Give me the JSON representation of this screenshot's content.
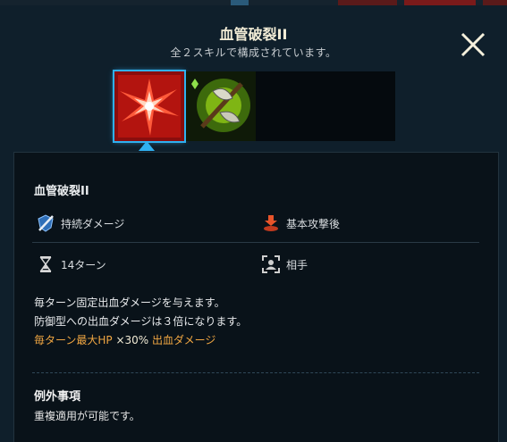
{
  "header": {
    "title": "血管破裂II",
    "subtitle": "全２スキルで構成されています。"
  },
  "skills": {
    "selected_index": 0,
    "icons": [
      "blood-burst-icon",
      "green-axe-icon",
      "empty-slot",
      "empty-slot"
    ]
  },
  "detail": {
    "name": "血管破裂II",
    "attributes": {
      "type": {
        "label": "持続ダメージ",
        "icon": "sword-shield-icon"
      },
      "timing": {
        "label": "基本攻撃後",
        "icon": "trigger-icon"
      },
      "duration": {
        "label": "14ターン",
        "icon": "hourglass-icon"
      },
      "target": {
        "label": "相手",
        "icon": "target-frame-icon"
      }
    },
    "description": {
      "line1": "毎ターン固定出血ダメージを与えます。",
      "line2": "防御型への出血ダメージは３倍になります。",
      "line3_a": "毎ターン最大HP ",
      "line3_b": "×30%",
      "line3_c": " 出血ダメージ"
    }
  },
  "exceptions": {
    "title": "例外事項",
    "text": "重複適用が可能です。"
  },
  "colors": {
    "background": "#0f1f2b",
    "panel": "#091219",
    "selection": "#2fb0f0",
    "highlight": "#f0a642"
  }
}
